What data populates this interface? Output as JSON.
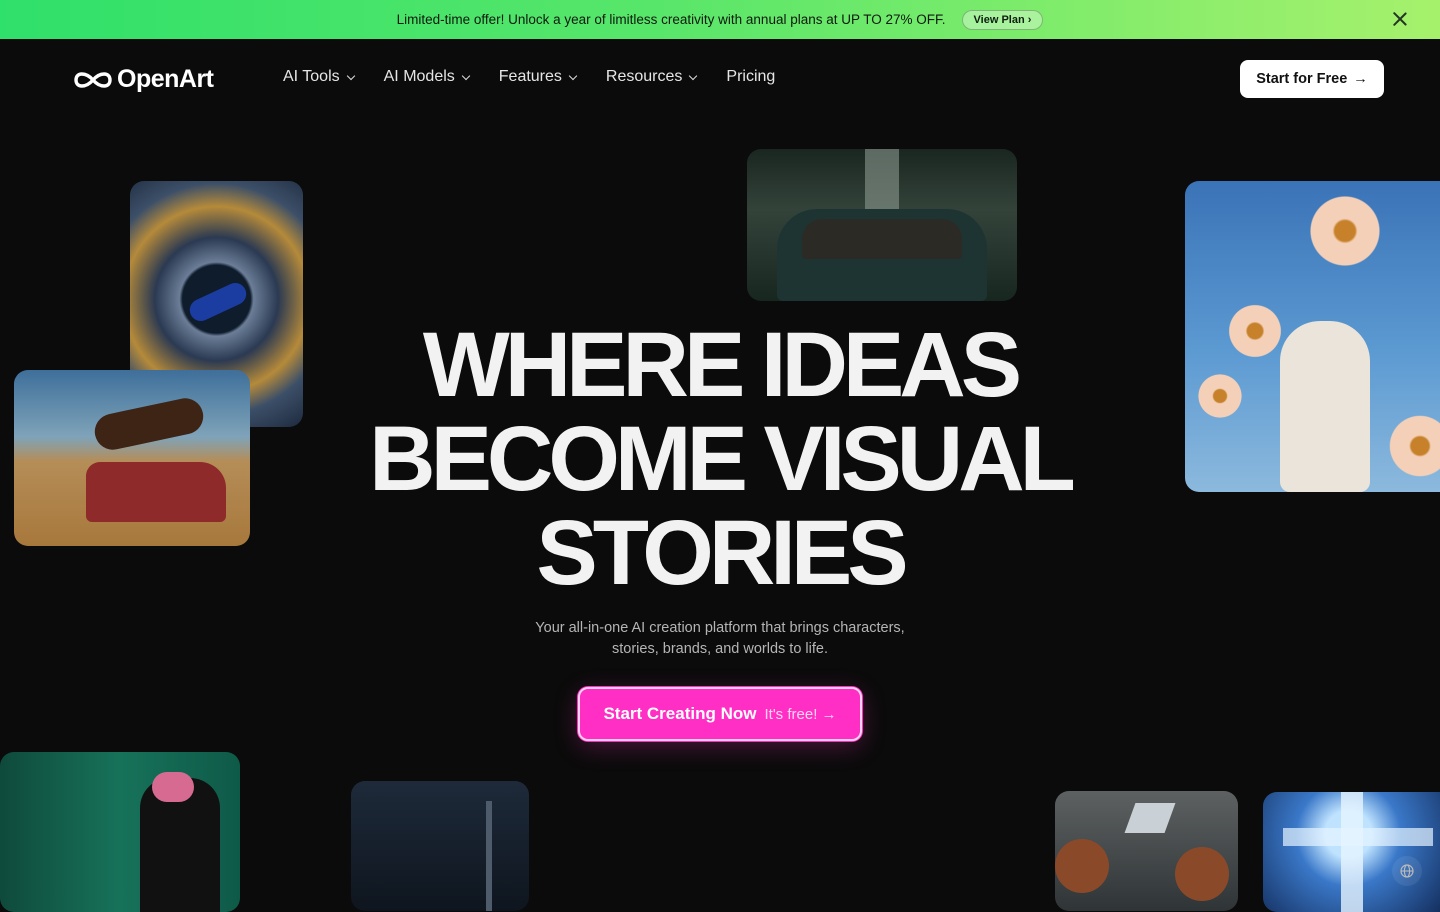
{
  "promo": {
    "text": "Limited-time offer! Unlock a year of limitless creativity with annual plans at UP TO 27% OFF.",
    "button_label": "View Plan ›"
  },
  "brand": {
    "name": "OpenArt"
  },
  "nav": {
    "items": [
      {
        "label": "AI Tools",
        "has_dropdown": true
      },
      {
        "label": "AI Models",
        "has_dropdown": true
      },
      {
        "label": "Features",
        "has_dropdown": true
      },
      {
        "label": "Resources",
        "has_dropdown": true
      },
      {
        "label": "Pricing",
        "has_dropdown": false
      }
    ],
    "cta_label": "Start for Free",
    "cta_arrow": "→"
  },
  "hero": {
    "title_line1": "WHERE IDEAS",
    "title_line2": "BECOME VISUAL",
    "title_line3": "STORIES",
    "subtitle_line1": "Your all-in-one AI creation platform that brings characters,",
    "subtitle_line2": "stories, brands, and worlds to life.",
    "cta_main": "Start Creating Now",
    "cta_sub": "It's free! →"
  },
  "colors": {
    "background": "#0b0b0b",
    "promo_start": "#2fe06a",
    "promo_end": "#a6f16c",
    "accent_pink": "#ff2ec5"
  },
  "icons": {
    "logo": "infinity-logo-icon",
    "close": "close-icon",
    "dropdown": "chevron-down-icon",
    "globe": "globe-icon"
  }
}
